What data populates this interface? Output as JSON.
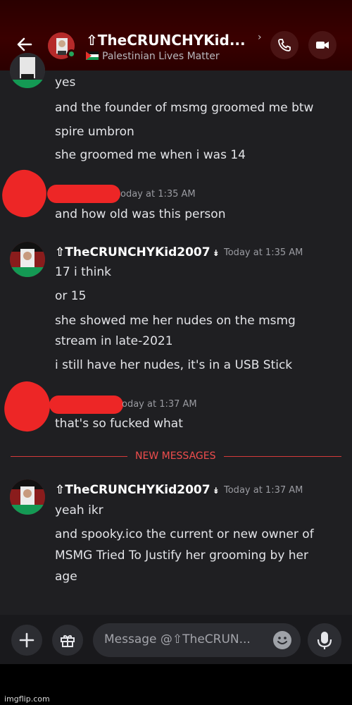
{
  "header": {
    "back_icon": "arrow-left-icon",
    "title": "⇧TheCRUNCHYKid...",
    "chevron": "›",
    "status_text": "Palestinian Lives Matter",
    "call_icon": "phone-icon",
    "video_icon": "video-camera-icon",
    "online_color": "#23a55a"
  },
  "messages": {
    "partial_group": {
      "lines": [
        "yes",
        "and the founder of msmg groomed me btw",
        "spire umbron",
        "she groomed me when i was 14"
      ]
    },
    "group1": {
      "timestamp": "oday at 1:35 AM",
      "lines": [
        "and how old was this person"
      ]
    },
    "group2": {
      "username": "⇧TheCRUNCHYKid2007",
      "badge": "↡",
      "timestamp": "Today at 1:35 AM",
      "lines": [
        "17 i think",
        "or 15",
        "she showed me her nudes on the msmg",
        "stream in late-2021",
        "i still have her nudes, it's in a USB Stick"
      ]
    },
    "group3": {
      "timestamp": "oday at 1:37 AM",
      "lines": [
        "that's so fucked what"
      ]
    },
    "divider": "NEW MESSAGES",
    "group4": {
      "username": "⇧TheCRUNCHYKid2007",
      "badge": "↡",
      "timestamp": "Today at 1:37 AM",
      "lines": [
        "yeah ikr",
        "and spooky.ico the current or new owner of",
        "MSMG Tried To Justify her grooming by her",
        "age"
      ]
    }
  },
  "composer": {
    "placeholder": "Message @⇧TheCRUN...",
    "add_icon": "plus-icon",
    "gift_icon": "gift-icon",
    "emoji_icon": "emoji-icon",
    "mic_icon": "microphone-icon"
  },
  "watermark": "imgflip.com",
  "colors": {
    "redaction": "#ed2626",
    "divider": "#ef4d4d",
    "header_bg": "#3a0000"
  }
}
